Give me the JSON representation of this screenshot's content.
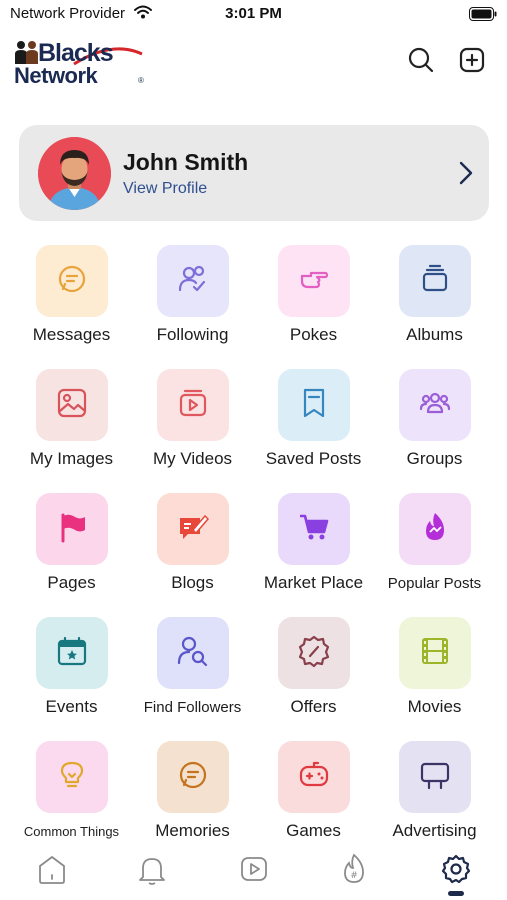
{
  "status_bar": {
    "carrier": "Network Provider",
    "time": "3:01 PM"
  },
  "header": {
    "logo": {
      "line1": "Blacks",
      "line2": "Network",
      "registered": "®"
    },
    "search_icon": "search-icon",
    "add_icon": "plus-square-icon"
  },
  "profile": {
    "name": "John Smith",
    "link": "View Profile"
  },
  "menu": [
    {
      "label": "Messages",
      "icon": "message-icon",
      "bg": "#fdebd2",
      "fg": "#e8a33b"
    },
    {
      "label": "Following",
      "icon": "user-check-icon",
      "bg": "#e7e5fb",
      "fg": "#7c6fd8"
    },
    {
      "label": "Pokes",
      "icon": "pointing-hand-icon",
      "bg": "#fde3f4",
      "fg": "#e25fc3"
    },
    {
      "label": "Albums",
      "icon": "album-stack-icon",
      "bg": "#dfe7f7",
      "fg": "#2f4f86"
    },
    {
      "label": "My Images",
      "icon": "image-icon",
      "bg": "#f8e3e3",
      "fg": "#d9545a"
    },
    {
      "label": "My Videos",
      "icon": "video-icon",
      "bg": "#fbe3e3",
      "fg": "#e0585e"
    },
    {
      "label": "Saved Posts",
      "icon": "bookmark-icon",
      "bg": "#dbeef8",
      "fg": "#3686c0"
    },
    {
      "label": "Groups",
      "icon": "groups-icon",
      "bg": "#ede3fb",
      "fg": "#9b5ed8"
    },
    {
      "label": "Pages",
      "icon": "flag-icon",
      "bg": "#fcd7ec",
      "fg": "#e9317f"
    },
    {
      "label": "Blogs",
      "icon": "blog-icon",
      "bg": "#fcdcd4",
      "fg": "#e8483a"
    },
    {
      "label": "Market Place",
      "icon": "cart-icon",
      "bg": "#e9dafb",
      "fg": "#8a3fe0"
    },
    {
      "label": "Popular Posts",
      "icon": "fire-icon",
      "bg": "#f4dcf7",
      "fg": "#b42fd8"
    },
    {
      "label": "Events",
      "icon": "calendar-icon",
      "bg": "#d6edf0",
      "fg": "#17787f"
    },
    {
      "label": "Find Followers",
      "icon": "user-search-icon",
      "bg": "#dfe0fa",
      "fg": "#5a55c8"
    },
    {
      "label": "Offers",
      "icon": "discount-badge-icon",
      "bg": "#ede1e3",
      "fg": "#8a3f4c"
    },
    {
      "label": "Movies",
      "icon": "film-icon",
      "bg": "#eef5d9",
      "fg": "#9db52a"
    },
    {
      "label": "Common Things",
      "icon": "lightbulb-icon",
      "bg": "#fbd9ef",
      "fg": "#e2a82b"
    },
    {
      "label": "Memories",
      "icon": "memories-icon",
      "bg": "#f5e1cf",
      "fg": "#c4741e"
    },
    {
      "label": "Games",
      "icon": "gamepad-icon",
      "bg": "#fbdcdc",
      "fg": "#df3a3f"
    },
    {
      "label": "Advertising",
      "icon": "billboard-icon",
      "bg": "#e3e1f2",
      "fg": "#3b3566"
    }
  ],
  "tabs": [
    {
      "icon": "home-icon",
      "active": false
    },
    {
      "icon": "bell-icon",
      "active": false
    },
    {
      "icon": "play-icon",
      "active": false
    },
    {
      "icon": "trending-icon",
      "active": false
    },
    {
      "icon": "settings-icon",
      "active": true
    }
  ]
}
